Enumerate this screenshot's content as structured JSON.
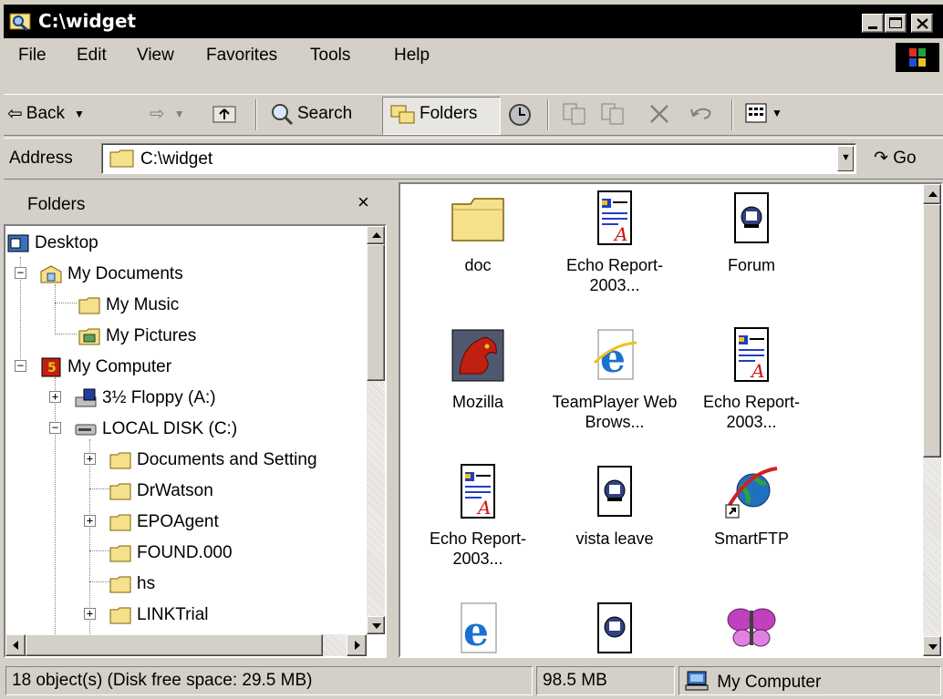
{
  "window": {
    "title": "C:\\widget"
  },
  "menu": [
    "File",
    "Edit",
    "View",
    "Favorites",
    "Tools",
    "Help"
  ],
  "toolbar": {
    "back_label": "Back",
    "search_label": "Search",
    "folders_label": "Folders"
  },
  "address": {
    "label": "Address",
    "value": "C:\\widget",
    "go_label": "Go"
  },
  "folders_pane": {
    "title": "Folders",
    "close": "×",
    "tree": [
      {
        "label": "Desktop",
        "icon": "desktop-icon"
      },
      {
        "label": "My Documents",
        "icon": "my-documents-icon",
        "expander": "−"
      },
      {
        "label": "My Music",
        "icon": "folder-icon"
      },
      {
        "label": "My Pictures",
        "icon": "pictures-folder-icon"
      },
      {
        "label": "My Computer",
        "icon": "my-computer-icon",
        "expander": "−"
      },
      {
        "label": "3½ Floppy (A:)",
        "icon": "floppy-drive-icon",
        "expander": "+"
      },
      {
        "label": "LOCAL DISK (C:)",
        "icon": "hard-disk-icon",
        "expander": "−"
      },
      {
        "label": "Documents and Setting",
        "icon": "folder-icon",
        "expander": "+"
      },
      {
        "label": "DrWatson",
        "icon": "folder-icon"
      },
      {
        "label": "EPOAgent",
        "icon": "folder-icon",
        "expander": "+"
      },
      {
        "label": "FOUND.000",
        "icon": "folder-icon"
      },
      {
        "label": "hs",
        "icon": "folder-icon"
      },
      {
        "label": "LINKTrial",
        "icon": "folder-icon",
        "expander": "+"
      }
    ]
  },
  "files": [
    {
      "label": "doc",
      "icon": "folder-icon"
    },
    {
      "label": "Echo Report-2003...",
      "icon": "report-document-icon"
    },
    {
      "label": "Forum",
      "icon": "web-shortcut-document-icon"
    },
    {
      "label": "Mozilla",
      "icon": "mozilla-icon"
    },
    {
      "label": "TeamPlayer Web Brows...",
      "icon": "internet-explorer-icon"
    },
    {
      "label": "Echo Report-2003...",
      "icon": "report-document-icon"
    },
    {
      "label": "Echo Report-2003...",
      "icon": "report-document-icon"
    },
    {
      "label": "vista leave",
      "icon": "web-shortcut-document-icon"
    },
    {
      "label": "SmartFTP",
      "icon": "smartftp-shortcut-icon"
    },
    {
      "label": "",
      "icon": "internet-explorer-icon"
    },
    {
      "label": "",
      "icon": "web-shortcut-document-icon"
    },
    {
      "label": "",
      "icon": "butterfly-shortcut-icon"
    }
  ],
  "status": {
    "objects": "18 object(s) (Disk free space: 29.5 MB)",
    "size": "98.5 MB",
    "zone": "My Computer"
  },
  "colors": {
    "titlebar": "#000000",
    "face": "#d4d0c8",
    "folder_yellow": "#f5e08c"
  }
}
